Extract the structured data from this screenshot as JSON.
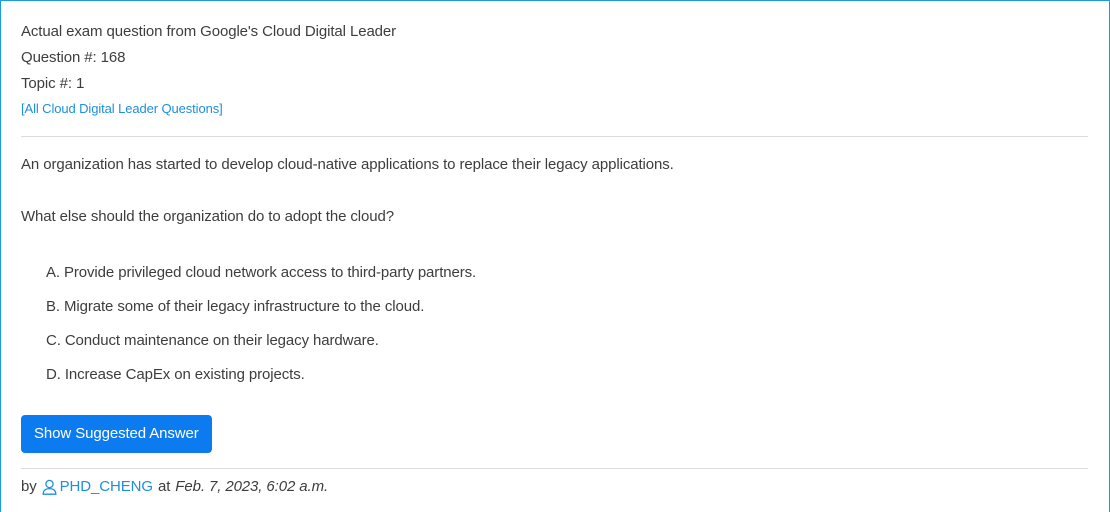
{
  "header": {
    "exam_line": "Actual exam question from Google's Cloud Digital Leader",
    "question_number": "Question #: 168",
    "topic": "Topic #: 1",
    "all_questions_link": "[All Cloud Digital Leader Questions]"
  },
  "question": {
    "text": "An organization has started to develop cloud-native applications to replace their legacy applications.",
    "prompt": "What else should the organization do to adopt the cloud?",
    "choices": [
      {
        "letter": "A.",
        "text": "Provide privileged cloud network access to third-party partners."
      },
      {
        "letter": "B.",
        "text": "Migrate some of their legacy infrastructure to the cloud."
      },
      {
        "letter": "C.",
        "text": "Conduct maintenance on their legacy hardware."
      },
      {
        "letter": "D.",
        "text": "Increase CapEx on existing projects."
      }
    ]
  },
  "actions": {
    "show_answer_label": "Show Suggested Answer"
  },
  "meta": {
    "by_label": "by",
    "user_icon": "user-outline-icon",
    "username": "PHD_CHENG",
    "at_label": "at",
    "date": "Feb. 7, 2023, 6:02 a.m."
  },
  "colors": {
    "border": "#1b9bd7",
    "link": "#1f8fdc",
    "button": "#0d7bf0",
    "text": "#3d3d3d"
  }
}
